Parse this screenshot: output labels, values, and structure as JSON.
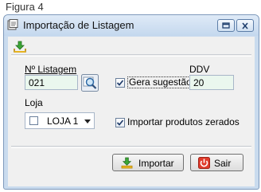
{
  "caption": "Figura 4",
  "window": {
    "title": "Importação de Listagem",
    "icon": "window-app-icon",
    "controls": [
      "minimize-icon",
      "close-icon"
    ]
  },
  "toolbar": {
    "icon": "download-icon"
  },
  "form": {
    "listagem_label": "Nº Listagem",
    "listagem_value": "021",
    "lookup_icon": "magnifier-icon",
    "gera_sugestao_label": "Gera sugestão",
    "gera_sugestao_checked": true,
    "ddv_label": "DDV",
    "ddv_value": "20",
    "loja_label": "Loja",
    "loja_value": "LOJA 1",
    "importar_zerados_label": "Importar produtos zerados",
    "importar_zerados_checked": true
  },
  "buttons": {
    "importar_label": "Importar",
    "importar_icon": "download-icon",
    "sair_label": "Sair",
    "sair_icon": "power-icon"
  },
  "colors": {
    "field_bg": "#eaf7ee",
    "window_frame": "#c9dbee",
    "exit_red": "#e03a2b",
    "download_green": "#3aa634"
  }
}
